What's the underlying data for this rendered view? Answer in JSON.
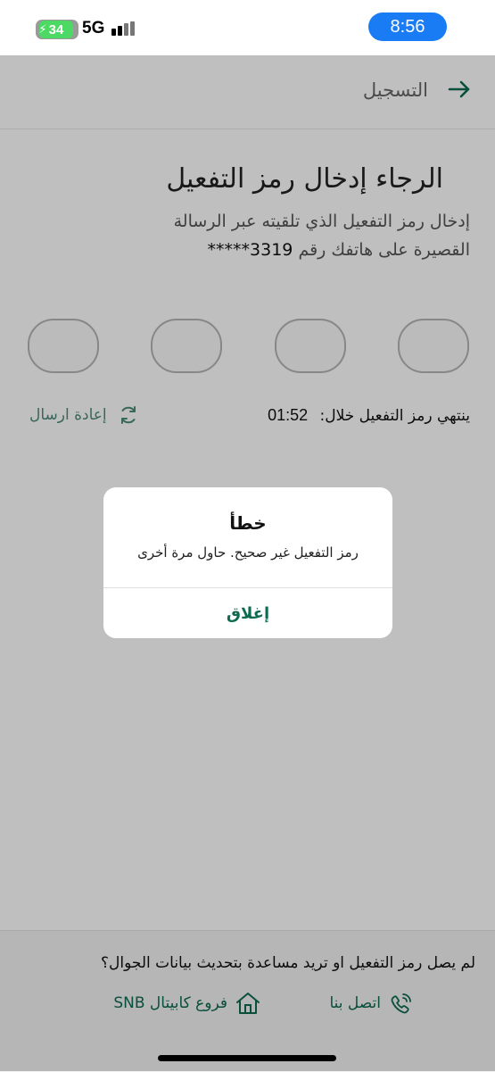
{
  "status_bar": {
    "battery": "34",
    "network": "5G",
    "time": "8:56"
  },
  "header": {
    "title": "التسجيل",
    "back_icon": "arrow-right-icon"
  },
  "content": {
    "title": "الرجاء إدخال رمز التفعيل",
    "subtitle_line1": "إدخال رمز التفعيل الذي تلقيته عبر الرسالة",
    "subtitle_line2": "القصيرة على هاتفك رقم",
    "masked_number": "3319*****",
    "otp_count": 4,
    "resend_label": "إعادة ارسال",
    "resend_icon": "refresh-icon",
    "expiry_label": "ينتهي رمز التفعيل خلال:",
    "expiry_timer": "01:52"
  },
  "footer": {
    "question": "لم يصل رمز التفعيل او تريد مساعدة بتحديث بيانات الجوال؟",
    "contact_label": "اتصل بنا",
    "contact_icon": "phone-icon",
    "branches_label": "فروع كابيتال SNB",
    "branches_icon": "home-icon"
  },
  "dialog": {
    "title": "خطأ",
    "message": "رمز التفعيل غير صحيح. حاول مرة أخرى",
    "close_label": "إغلاق"
  },
  "colors": {
    "accent": "#0d6b50",
    "time_pill": "#1a7cf5",
    "battery": "#4cd964"
  }
}
